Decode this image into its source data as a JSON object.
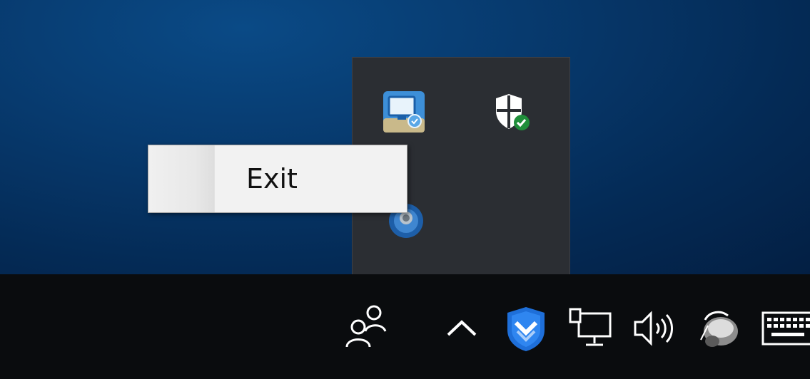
{
  "context_menu": {
    "items": [
      {
        "label": "Exit"
      }
    ]
  },
  "tray_overflow": {
    "icons": [
      {
        "name": "display-app-icon"
      },
      {
        "name": "windows-security-icon"
      },
      {
        "name": "blue-round-app-icon"
      }
    ]
  },
  "taskbar": {
    "icons": [
      {
        "name": "people-icon"
      },
      {
        "name": "chevron-up-icon"
      },
      {
        "name": "shield-app-icon"
      },
      {
        "name": "network-icon"
      },
      {
        "name": "volume-icon"
      },
      {
        "name": "speaker-device-icon"
      },
      {
        "name": "keyboard-icon"
      }
    ]
  },
  "colors": {
    "accent": "#1e6fd9",
    "security_green": "#1f8e3a"
  }
}
